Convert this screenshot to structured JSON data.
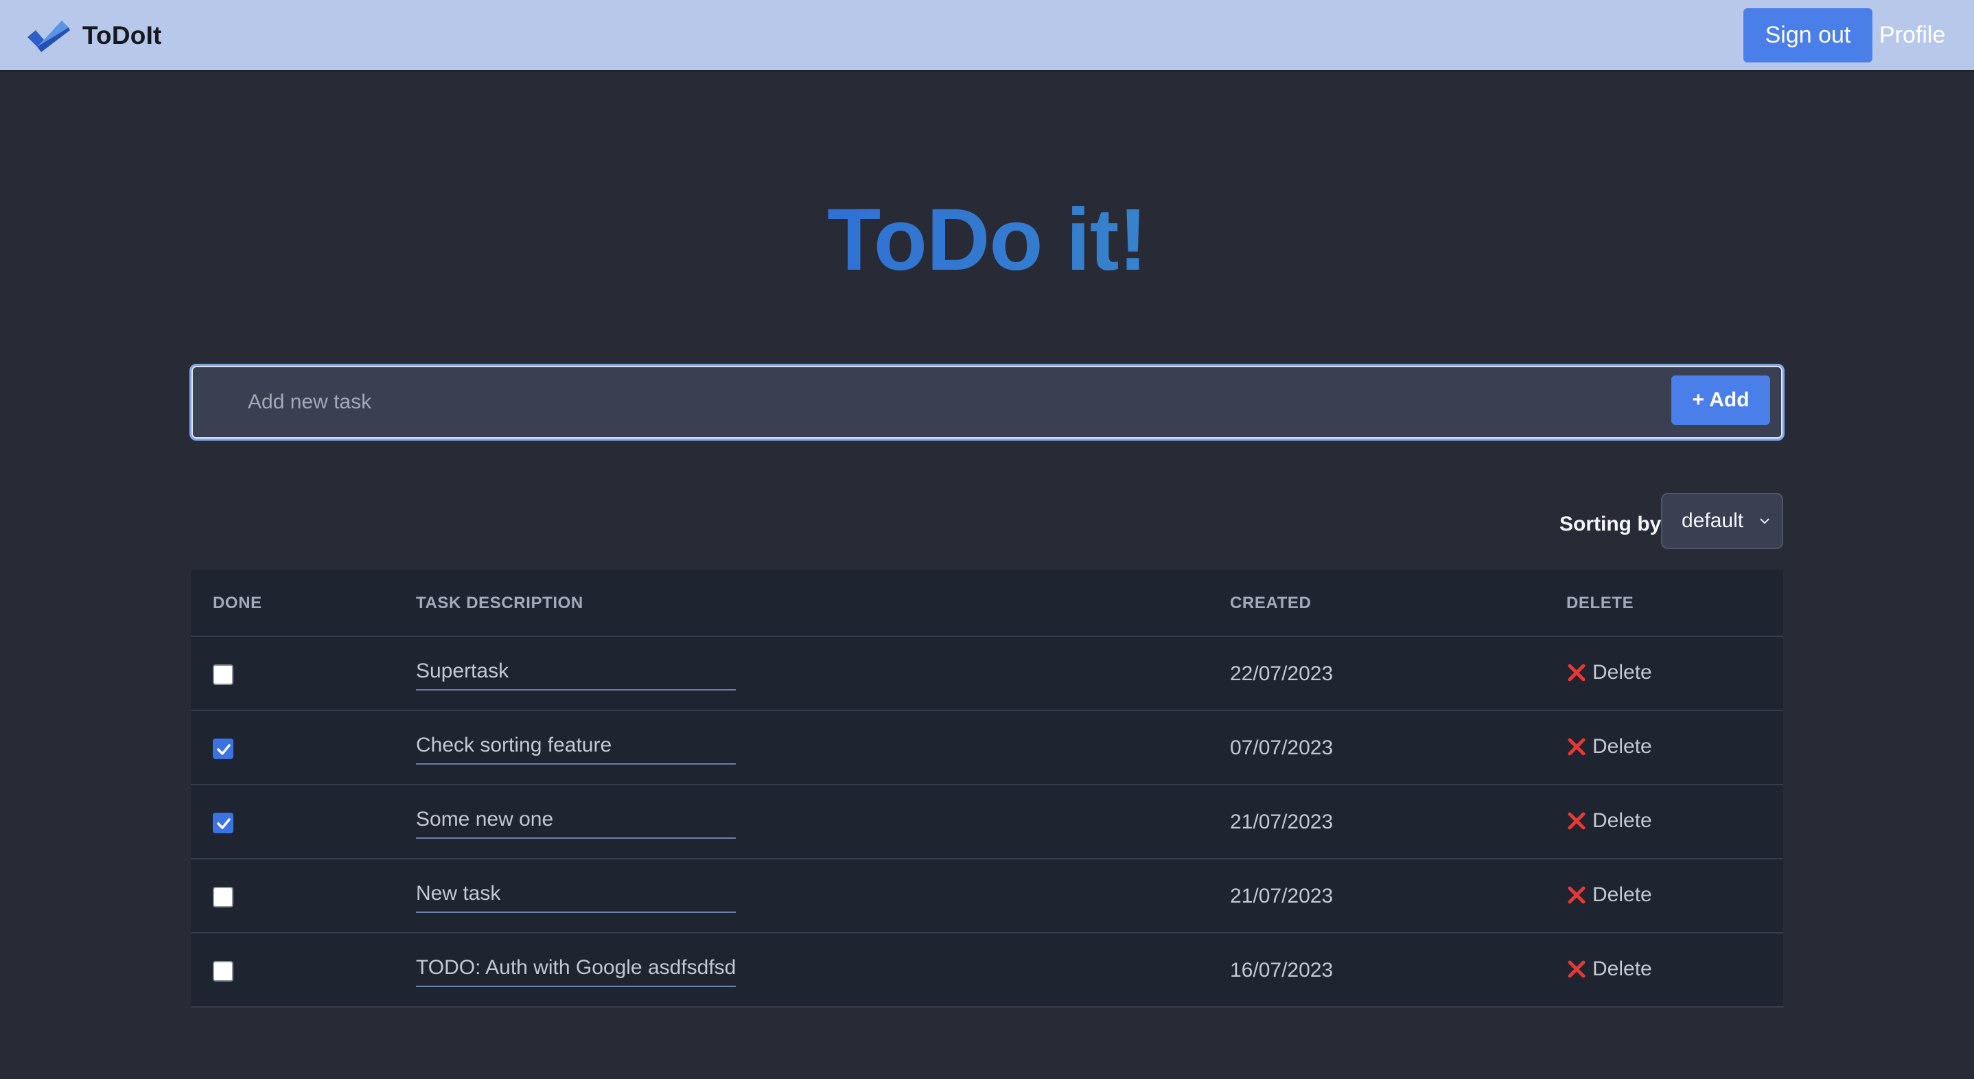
{
  "nav": {
    "brand": "ToDoIt",
    "logo_icon": "double-checkmark-logo-icon",
    "signout_label": "Sign out",
    "profile_label": "Profile"
  },
  "hero": {
    "title": "ToDo it!"
  },
  "add_task": {
    "placeholder": "Add new task",
    "value": "",
    "button_label": "+ Add"
  },
  "sorting": {
    "label": "Sorting by:",
    "selected": "default",
    "chevron_icon": "chevron-down-icon"
  },
  "table": {
    "headers": {
      "done": "DONE",
      "description": "TASK DESCRIPTION",
      "created": "CREATED",
      "delete": "DELETE"
    },
    "rows": [
      {
        "done": false,
        "description": "Supertask",
        "created": "22/07/2023",
        "delete_label": "Delete"
      },
      {
        "done": true,
        "description": "Check sorting feature",
        "created": "07/07/2023",
        "delete_label": "Delete"
      },
      {
        "done": true,
        "description": "Some new one",
        "created": "21/07/2023",
        "delete_label": "Delete"
      },
      {
        "done": false,
        "description": "New task",
        "created": "21/07/2023",
        "delete_label": "Delete"
      },
      {
        "done": false,
        "description": "TODO: Auth with Google asdfsdfsdf",
        "created": "16/07/2023",
        "delete_label": "Delete"
      }
    ]
  },
  "colors": {
    "nav_bg": "#b8c8ea",
    "page_bg": "#282b35",
    "accent": "#4a7ee8",
    "delete_icon": "#e53935",
    "table_bg": "#1f2431"
  }
}
